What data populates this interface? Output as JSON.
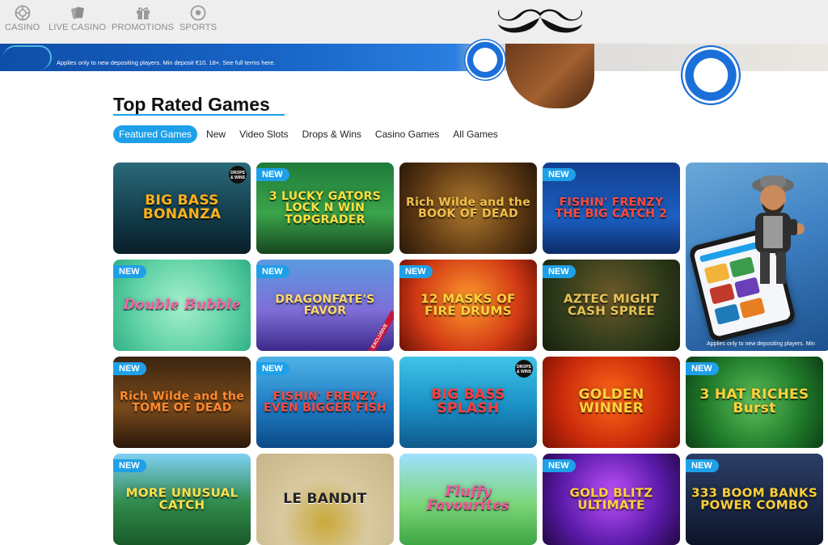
{
  "nav": {
    "items": [
      {
        "label": "CASINO",
        "icon": "roulette-icon"
      },
      {
        "label": "LIVE CASINO",
        "icon": "cards-icon"
      },
      {
        "label": "PROMOTIONS",
        "icon": "gift-icon"
      },
      {
        "label": "SPORTS",
        "icon": "football-icon"
      }
    ],
    "logo": "mustache-logo"
  },
  "promo_banner": {
    "terms": "Applies only to new depositing players. Min deposit €10. 18+. See full terms here."
  },
  "section": {
    "title": "Top Rated Games",
    "tabs": [
      "Featured Games",
      "New",
      "Video Slots",
      "Drops & Wins",
      "Casino Games",
      "All Games"
    ],
    "active_tab": "Featured Games"
  },
  "badge_label": "NEW",
  "games": [
    {
      "title": "BIG BASS BONANZA",
      "new": false,
      "corner": "DROPS & WINS"
    },
    {
      "title": "3 LUCKY GATORS LOCK N WIN TOPGRADER",
      "new": true
    },
    {
      "title": "Rich Wilde and the BOOK OF DEAD",
      "new": false
    },
    {
      "title": "FISHIN' FRENZY THE BIG CATCH 2",
      "new": true
    },
    {
      "title": "Double Bubble",
      "new": true
    },
    {
      "title": "DRAGONFATE'S FAVOR",
      "new": true,
      "ribbon": "EXCLUSIVE"
    },
    {
      "title": "12 MASKS OF FIRE DRUMS",
      "new": true
    },
    {
      "title": "AZTEC MIGHT CASH SPREE",
      "new": true
    },
    {
      "title": "Rich Wilde and the TOME OF DEAD",
      "new": true
    },
    {
      "title": "FISHIN' FRENZY EVEN BIGGER FISH",
      "new": true
    },
    {
      "title": "BIG BASS SPLASH",
      "new": false,
      "corner": "DROPS & WINS"
    },
    {
      "title": "GOLDEN WINNER",
      "new": false
    },
    {
      "title": "3 HAT RICHES Burst",
      "new": true
    },
    {
      "title": "MORE UNUSUAL CATCH",
      "new": true
    },
    {
      "title": "LE BANDIT",
      "new": false
    },
    {
      "title": "Fluffy Favourites",
      "new": false
    },
    {
      "title": "GOLD BLITZ ULTIMATE",
      "new": true
    },
    {
      "title": "333 BOOM BANKS POWER COMBO",
      "new": true
    }
  ],
  "promo_tile": {
    "terms": "Applies only to new depositing players. Min"
  },
  "colors": {
    "accent": "#1ea0e8",
    "nav_text": "#8c8c8c",
    "nav_bg": "#eeeeee"
  }
}
